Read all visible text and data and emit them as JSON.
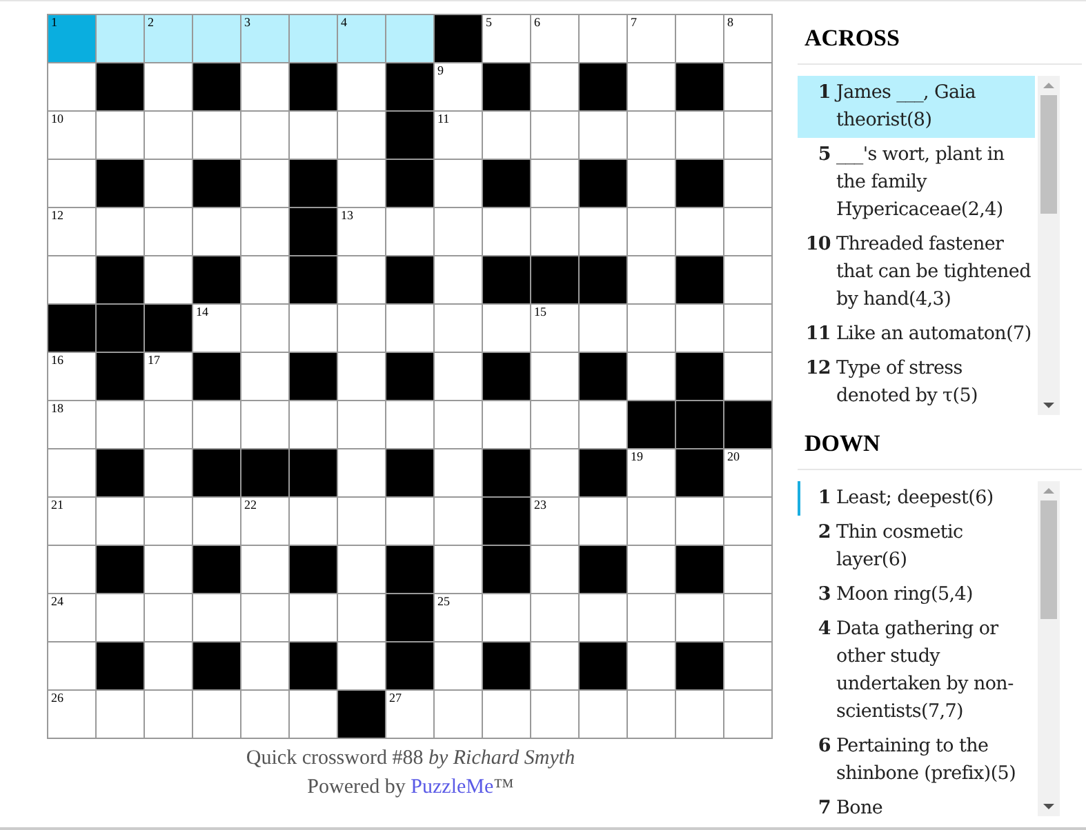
{
  "grid": {
    "rows": [
      [
        {
          "kind": "open",
          "number": "1",
          "selected": true,
          "in_word": true
        },
        {
          "kind": "open",
          "selected": false,
          "in_word": true
        },
        {
          "kind": "open",
          "number": "2",
          "selected": false,
          "in_word": true
        },
        {
          "kind": "open",
          "selected": false,
          "in_word": true
        },
        {
          "kind": "open",
          "number": "3",
          "selected": false,
          "in_word": true
        },
        {
          "kind": "open",
          "selected": false,
          "in_word": true
        },
        {
          "kind": "open",
          "number": "4",
          "selected": false,
          "in_word": true
        },
        {
          "kind": "open",
          "selected": false,
          "in_word": true
        },
        {
          "kind": "block"
        },
        {
          "kind": "open",
          "number": "5",
          "selected": false,
          "in_word": false
        },
        {
          "kind": "open",
          "number": "6",
          "selected": false,
          "in_word": false
        },
        {
          "kind": "open",
          "selected": false,
          "in_word": false
        },
        {
          "kind": "open",
          "number": "7",
          "selected": false,
          "in_word": false
        },
        {
          "kind": "open",
          "selected": false,
          "in_word": false
        },
        {
          "kind": "open",
          "number": "8",
          "selected": false,
          "in_word": false
        }
      ],
      [
        {
          "kind": "open",
          "selected": false,
          "in_word": false
        },
        {
          "kind": "block"
        },
        {
          "kind": "open",
          "selected": false,
          "in_word": false
        },
        {
          "kind": "block"
        },
        {
          "kind": "open",
          "selected": false,
          "in_word": false
        },
        {
          "kind": "block"
        },
        {
          "kind": "open",
          "selected": false,
          "in_word": false
        },
        {
          "kind": "block"
        },
        {
          "kind": "open",
          "number": "9",
          "selected": false,
          "in_word": false
        },
        {
          "kind": "block"
        },
        {
          "kind": "open",
          "selected": false,
          "in_word": false
        },
        {
          "kind": "block"
        },
        {
          "kind": "open",
          "selected": false,
          "in_word": false
        },
        {
          "kind": "block"
        },
        {
          "kind": "open",
          "selected": false,
          "in_word": false
        }
      ],
      [
        {
          "kind": "open",
          "number": "10",
          "selected": false,
          "in_word": false
        },
        {
          "kind": "open",
          "selected": false,
          "in_word": false
        },
        {
          "kind": "open",
          "selected": false,
          "in_word": false
        },
        {
          "kind": "open",
          "selected": false,
          "in_word": false
        },
        {
          "kind": "open",
          "selected": false,
          "in_word": false
        },
        {
          "kind": "open",
          "selected": false,
          "in_word": false
        },
        {
          "kind": "open",
          "selected": false,
          "in_word": false
        },
        {
          "kind": "block"
        },
        {
          "kind": "open",
          "number": "11",
          "selected": false,
          "in_word": false
        },
        {
          "kind": "open",
          "selected": false,
          "in_word": false
        },
        {
          "kind": "open",
          "selected": false,
          "in_word": false
        },
        {
          "kind": "open",
          "selected": false,
          "in_word": false
        },
        {
          "kind": "open",
          "selected": false,
          "in_word": false
        },
        {
          "kind": "open",
          "selected": false,
          "in_word": false
        },
        {
          "kind": "open",
          "selected": false,
          "in_word": false
        }
      ],
      [
        {
          "kind": "open",
          "selected": false,
          "in_word": false
        },
        {
          "kind": "block"
        },
        {
          "kind": "open",
          "selected": false,
          "in_word": false
        },
        {
          "kind": "block"
        },
        {
          "kind": "open",
          "selected": false,
          "in_word": false
        },
        {
          "kind": "block"
        },
        {
          "kind": "open",
          "selected": false,
          "in_word": false
        },
        {
          "kind": "block"
        },
        {
          "kind": "open",
          "selected": false,
          "in_word": false
        },
        {
          "kind": "block"
        },
        {
          "kind": "open",
          "selected": false,
          "in_word": false
        },
        {
          "kind": "block"
        },
        {
          "kind": "open",
          "selected": false,
          "in_word": false
        },
        {
          "kind": "block"
        },
        {
          "kind": "open",
          "selected": false,
          "in_word": false
        }
      ],
      [
        {
          "kind": "open",
          "number": "12",
          "selected": false,
          "in_word": false
        },
        {
          "kind": "open",
          "selected": false,
          "in_word": false
        },
        {
          "kind": "open",
          "selected": false,
          "in_word": false
        },
        {
          "kind": "open",
          "selected": false,
          "in_word": false
        },
        {
          "kind": "open",
          "selected": false,
          "in_word": false
        },
        {
          "kind": "block"
        },
        {
          "kind": "open",
          "number": "13",
          "selected": false,
          "in_word": false
        },
        {
          "kind": "open",
          "selected": false,
          "in_word": false
        },
        {
          "kind": "open",
          "selected": false,
          "in_word": false
        },
        {
          "kind": "open",
          "selected": false,
          "in_word": false
        },
        {
          "kind": "open",
          "selected": false,
          "in_word": false
        },
        {
          "kind": "open",
          "selected": false,
          "in_word": false
        },
        {
          "kind": "open",
          "selected": false,
          "in_word": false
        },
        {
          "kind": "open",
          "selected": false,
          "in_word": false
        },
        {
          "kind": "open",
          "selected": false,
          "in_word": false
        }
      ],
      [
        {
          "kind": "open",
          "selected": false,
          "in_word": false
        },
        {
          "kind": "block"
        },
        {
          "kind": "open",
          "selected": false,
          "in_word": false
        },
        {
          "kind": "block"
        },
        {
          "kind": "open",
          "selected": false,
          "in_word": false
        },
        {
          "kind": "block"
        },
        {
          "kind": "open",
          "selected": false,
          "in_word": false
        },
        {
          "kind": "block"
        },
        {
          "kind": "open",
          "selected": false,
          "in_word": false
        },
        {
          "kind": "block"
        },
        {
          "kind": "block"
        },
        {
          "kind": "block"
        },
        {
          "kind": "open",
          "selected": false,
          "in_word": false
        },
        {
          "kind": "block"
        },
        {
          "kind": "open",
          "selected": false,
          "in_word": false
        }
      ],
      [
        {
          "kind": "block"
        },
        {
          "kind": "block"
        },
        {
          "kind": "block"
        },
        {
          "kind": "open",
          "number": "14",
          "selected": false,
          "in_word": false
        },
        {
          "kind": "open",
          "selected": false,
          "in_word": false
        },
        {
          "kind": "open",
          "selected": false,
          "in_word": false
        },
        {
          "kind": "open",
          "selected": false,
          "in_word": false
        },
        {
          "kind": "open",
          "selected": false,
          "in_word": false
        },
        {
          "kind": "open",
          "selected": false,
          "in_word": false
        },
        {
          "kind": "open",
          "selected": false,
          "in_word": false
        },
        {
          "kind": "open",
          "number": "15",
          "selected": false,
          "in_word": false
        },
        {
          "kind": "open",
          "selected": false,
          "in_word": false
        },
        {
          "kind": "open",
          "selected": false,
          "in_word": false
        },
        {
          "kind": "open",
          "selected": false,
          "in_word": false
        },
        {
          "kind": "open",
          "selected": false,
          "in_word": false
        }
      ],
      [
        {
          "kind": "open",
          "number": "16",
          "selected": false,
          "in_word": false
        },
        {
          "kind": "block"
        },
        {
          "kind": "open",
          "number": "17",
          "selected": false,
          "in_word": false
        },
        {
          "kind": "block"
        },
        {
          "kind": "open",
          "selected": false,
          "in_word": false
        },
        {
          "kind": "block"
        },
        {
          "kind": "open",
          "selected": false,
          "in_word": false
        },
        {
          "kind": "block"
        },
        {
          "kind": "open",
          "selected": false,
          "in_word": false
        },
        {
          "kind": "block"
        },
        {
          "kind": "open",
          "selected": false,
          "in_word": false
        },
        {
          "kind": "block"
        },
        {
          "kind": "open",
          "selected": false,
          "in_word": false
        },
        {
          "kind": "block"
        },
        {
          "kind": "open",
          "selected": false,
          "in_word": false
        }
      ],
      [
        {
          "kind": "open",
          "number": "18",
          "selected": false,
          "in_word": false
        },
        {
          "kind": "open",
          "selected": false,
          "in_word": false
        },
        {
          "kind": "open",
          "selected": false,
          "in_word": false
        },
        {
          "kind": "open",
          "selected": false,
          "in_word": false
        },
        {
          "kind": "open",
          "selected": false,
          "in_word": false
        },
        {
          "kind": "open",
          "selected": false,
          "in_word": false
        },
        {
          "kind": "open",
          "selected": false,
          "in_word": false
        },
        {
          "kind": "open",
          "selected": false,
          "in_word": false
        },
        {
          "kind": "open",
          "selected": false,
          "in_word": false
        },
        {
          "kind": "open",
          "selected": false,
          "in_word": false
        },
        {
          "kind": "open",
          "selected": false,
          "in_word": false
        },
        {
          "kind": "open",
          "selected": false,
          "in_word": false
        },
        {
          "kind": "block"
        },
        {
          "kind": "block"
        },
        {
          "kind": "block"
        }
      ],
      [
        {
          "kind": "open",
          "selected": false,
          "in_word": false
        },
        {
          "kind": "block"
        },
        {
          "kind": "open",
          "selected": false,
          "in_word": false
        },
        {
          "kind": "block"
        },
        {
          "kind": "block"
        },
        {
          "kind": "block"
        },
        {
          "kind": "open",
          "selected": false,
          "in_word": false
        },
        {
          "kind": "block"
        },
        {
          "kind": "open",
          "selected": false,
          "in_word": false
        },
        {
          "kind": "block"
        },
        {
          "kind": "open",
          "selected": false,
          "in_word": false
        },
        {
          "kind": "block"
        },
        {
          "kind": "open",
          "number": "19",
          "selected": false,
          "in_word": false
        },
        {
          "kind": "block"
        },
        {
          "kind": "open",
          "number": "20",
          "selected": false,
          "in_word": false
        }
      ],
      [
        {
          "kind": "open",
          "number": "21",
          "selected": false,
          "in_word": false
        },
        {
          "kind": "open",
          "selected": false,
          "in_word": false
        },
        {
          "kind": "open",
          "selected": false,
          "in_word": false
        },
        {
          "kind": "open",
          "selected": false,
          "in_word": false
        },
        {
          "kind": "open",
          "number": "22",
          "selected": false,
          "in_word": false
        },
        {
          "kind": "open",
          "selected": false,
          "in_word": false
        },
        {
          "kind": "open",
          "selected": false,
          "in_word": false
        },
        {
          "kind": "open",
          "selected": false,
          "in_word": false
        },
        {
          "kind": "open",
          "selected": false,
          "in_word": false
        },
        {
          "kind": "block"
        },
        {
          "kind": "open",
          "number": "23",
          "selected": false,
          "in_word": false
        },
        {
          "kind": "open",
          "selected": false,
          "in_word": false
        },
        {
          "kind": "open",
          "selected": false,
          "in_word": false
        },
        {
          "kind": "open",
          "selected": false,
          "in_word": false
        },
        {
          "kind": "open",
          "selected": false,
          "in_word": false
        }
      ],
      [
        {
          "kind": "open",
          "selected": false,
          "in_word": false
        },
        {
          "kind": "block"
        },
        {
          "kind": "open",
          "selected": false,
          "in_word": false
        },
        {
          "kind": "block"
        },
        {
          "kind": "open",
          "selected": false,
          "in_word": false
        },
        {
          "kind": "block"
        },
        {
          "kind": "open",
          "selected": false,
          "in_word": false
        },
        {
          "kind": "block"
        },
        {
          "kind": "open",
          "selected": false,
          "in_word": false
        },
        {
          "kind": "block"
        },
        {
          "kind": "open",
          "selected": false,
          "in_word": false
        },
        {
          "kind": "block"
        },
        {
          "kind": "open",
          "selected": false,
          "in_word": false
        },
        {
          "kind": "block"
        },
        {
          "kind": "open",
          "selected": false,
          "in_word": false
        }
      ],
      [
        {
          "kind": "open",
          "number": "24",
          "selected": false,
          "in_word": false
        },
        {
          "kind": "open",
          "selected": false,
          "in_word": false
        },
        {
          "kind": "open",
          "selected": false,
          "in_word": false
        },
        {
          "kind": "open",
          "selected": false,
          "in_word": false
        },
        {
          "kind": "open",
          "selected": false,
          "in_word": false
        },
        {
          "kind": "open",
          "selected": false,
          "in_word": false
        },
        {
          "kind": "open",
          "selected": false,
          "in_word": false
        },
        {
          "kind": "block"
        },
        {
          "kind": "open",
          "number": "25",
          "selected": false,
          "in_word": false
        },
        {
          "kind": "open",
          "selected": false,
          "in_word": false
        },
        {
          "kind": "open",
          "selected": false,
          "in_word": false
        },
        {
          "kind": "open",
          "selected": false,
          "in_word": false
        },
        {
          "kind": "open",
          "selected": false,
          "in_word": false
        },
        {
          "kind": "open",
          "selected": false,
          "in_word": false
        },
        {
          "kind": "open",
          "selected": false,
          "in_word": false
        }
      ],
      [
        {
          "kind": "open",
          "selected": false,
          "in_word": false
        },
        {
          "kind": "block"
        },
        {
          "kind": "open",
          "selected": false,
          "in_word": false
        },
        {
          "kind": "block"
        },
        {
          "kind": "open",
          "selected": false,
          "in_word": false
        },
        {
          "kind": "block"
        },
        {
          "kind": "open",
          "selected": false,
          "in_word": false
        },
        {
          "kind": "block"
        },
        {
          "kind": "open",
          "selected": false,
          "in_word": false
        },
        {
          "kind": "block"
        },
        {
          "kind": "open",
          "selected": false,
          "in_word": false
        },
        {
          "kind": "block"
        },
        {
          "kind": "open",
          "selected": false,
          "in_word": false
        },
        {
          "kind": "block"
        },
        {
          "kind": "open",
          "selected": false,
          "in_word": false
        }
      ],
      [
        {
          "kind": "open",
          "number": "26",
          "selected": false,
          "in_word": false
        },
        {
          "kind": "open",
          "selected": false,
          "in_word": false
        },
        {
          "kind": "open",
          "selected": false,
          "in_word": false
        },
        {
          "kind": "open",
          "selected": false,
          "in_word": false
        },
        {
          "kind": "open",
          "selected": false,
          "in_word": false
        },
        {
          "kind": "open",
          "selected": false,
          "in_word": false
        },
        {
          "kind": "block"
        },
        {
          "kind": "open",
          "number": "27",
          "selected": false,
          "in_word": false
        },
        {
          "kind": "open",
          "selected": false,
          "in_word": false
        },
        {
          "kind": "open",
          "selected": false,
          "in_word": false
        },
        {
          "kind": "open",
          "selected": false,
          "in_word": false
        },
        {
          "kind": "open",
          "selected": false,
          "in_word": false
        },
        {
          "kind": "open",
          "selected": false,
          "in_word": false
        },
        {
          "kind": "open",
          "selected": false,
          "in_word": false
        },
        {
          "kind": "open",
          "selected": false,
          "in_word": false
        }
      ]
    ]
  },
  "footer": {
    "title": "Quick crossword #88 *by Richard Smyth*",
    "powered_prefix": "Powered by ",
    "powered_link": "PuzzleMe",
    "powered_suffix": "™"
  },
  "clue_lists": [
    {
      "heading": "ACROSS",
      "kind": "fill",
      "clues": [
        {
          "number": "1",
          "text": "James ___, Gaia theorist(8)",
          "selected": true
        },
        {
          "number": "5",
          "text": "___'s wort, plant in the family Hypericaceae(2,4)",
          "selected": false
        },
        {
          "number": "10",
          "text": "Threaded fastener that can be tightened by hand(4,3)",
          "selected": false
        },
        {
          "number": "11",
          "text": "Like an automaton(7)",
          "selected": false
        },
        {
          "number": "12",
          "text": "Type of stress denoted by τ(5)",
          "selected": false
        }
      ]
    },
    {
      "heading": "DOWN",
      "kind": "bar",
      "clues": [
        {
          "number": "1",
          "text": "Least; deepest(6)",
          "selected": true
        },
        {
          "number": "2",
          "text": "Thin cosmetic layer(6)",
          "selected": false
        },
        {
          "number": "3",
          "text": "Moon ring(5,4)",
          "selected": false
        },
        {
          "number": "4",
          "text": "Data gathering or other study undertaken by non-scientists(7,7)",
          "selected": false
        },
        {
          "number": "6",
          "text": "Pertaining to the shinbone (prefix)(5)",
          "selected": false
        },
        {
          "number": "7",
          "text": "Bone",
          "selected": false
        }
      ]
    }
  ]
}
